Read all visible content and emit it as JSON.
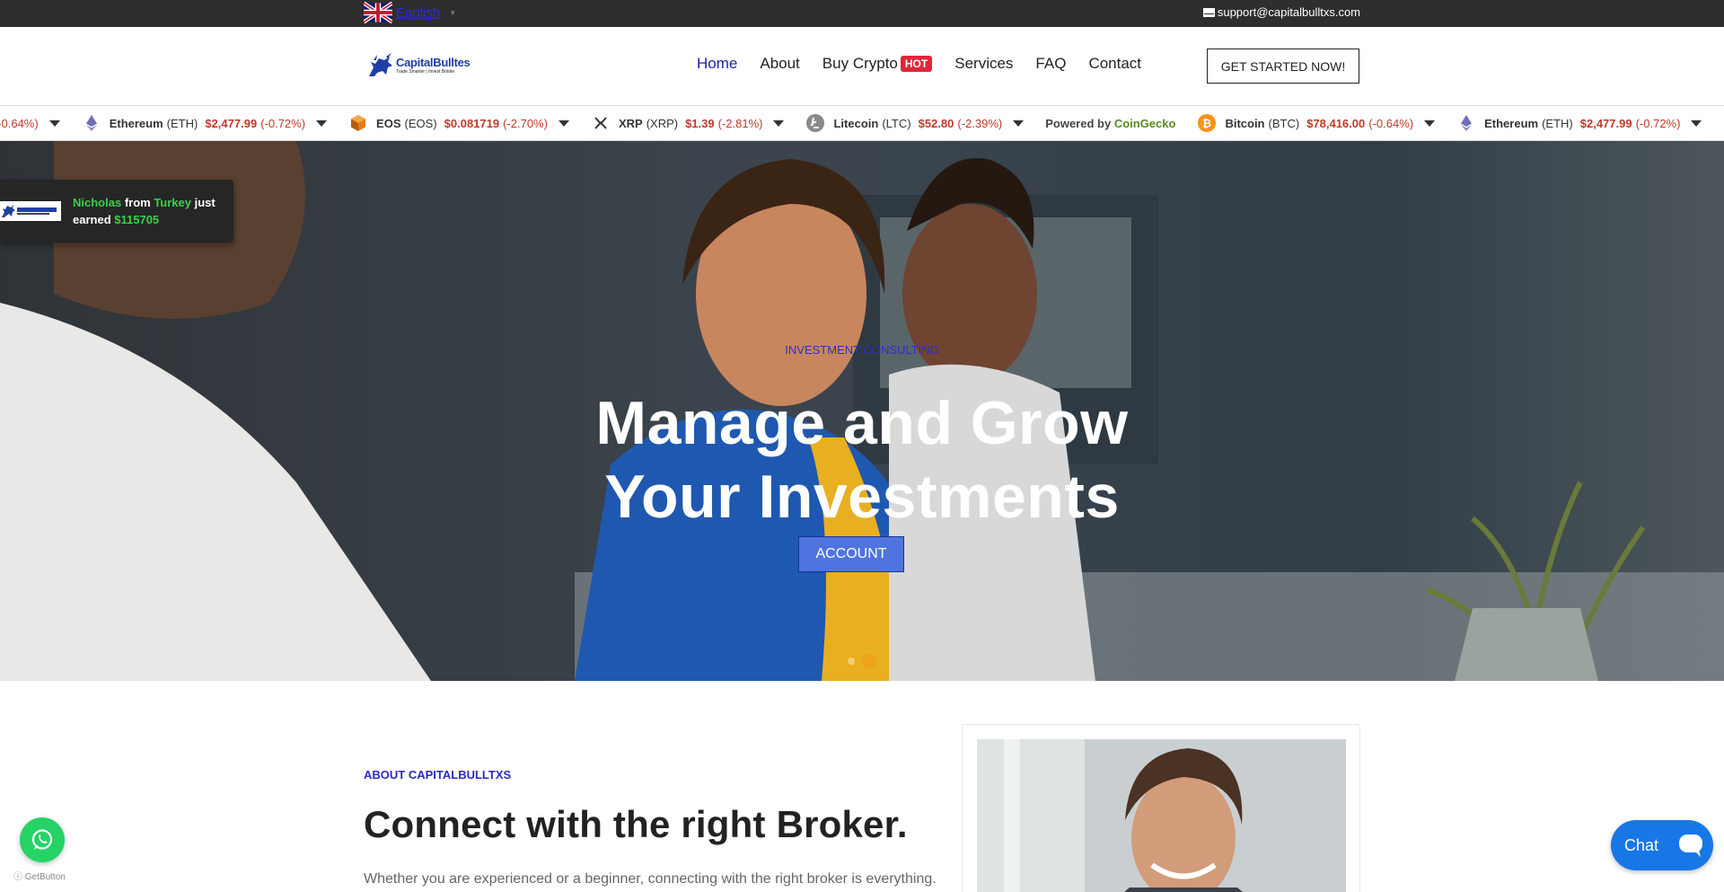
{
  "topbar": {
    "language": "English",
    "email": "support@capitalbulltxs.com"
  },
  "header": {
    "logo_name": "CapitalBulltes",
    "logo_tagline": "Trade Smarter | Invest Bolder",
    "nav": [
      {
        "label": "Home",
        "active": true
      },
      {
        "label": "About"
      },
      {
        "label": "Buy Crypto",
        "badge": "HOT"
      },
      {
        "label": "Services"
      },
      {
        "label": "FAQ"
      },
      {
        "label": "Contact"
      }
    ],
    "cta_label": "GET STARTED NOW!"
  },
  "ticker": {
    "lead_fragment": "0 (-0.64%)",
    "items": [
      {
        "name": "Ethereum",
        "symbol": "(ETH)",
        "price": "$2,477.99",
        "change": "(-0.72%)",
        "icon": "ethereum-icon"
      },
      {
        "name": "EOS",
        "symbol": "(EOS)",
        "price": "$0.081719",
        "change": "(-2.70%)",
        "icon": "eos-icon"
      },
      {
        "name": "XRP",
        "symbol": "(XRP)",
        "price": "$1.39",
        "change": "(-2.81%)",
        "icon": "xrp-icon"
      },
      {
        "name": "Litecoin",
        "symbol": "(LTC)",
        "price": "$52.80",
        "change": "(-2.39%)",
        "icon": "litecoin-icon"
      }
    ],
    "powered_by": "Powered by",
    "powered_brand": "CoinGecko",
    "items_repeat": [
      {
        "name": "Bitcoin",
        "symbol": "(BTC)",
        "price": "$78,416.00",
        "change": "(-0.64%)",
        "icon": "bitcoin-icon"
      },
      {
        "name": "Ethereum",
        "symbol": "(ETH)",
        "price": "$2,477.99",
        "change": "(-0.72%)",
        "icon": "ethereum-icon"
      }
    ],
    "tail_fragment": "E",
    "negative_color": "#c0392b"
  },
  "hero": {
    "eyebrow": "INVESTMENT CONSULTING",
    "title_line1": "Manage and Grow",
    "title_line2": "Your Investments",
    "button": "ACCOUNT",
    "slides_total": 2,
    "slide_active": 2
  },
  "notification": {
    "name": "Nicholas",
    "from": "from",
    "country": "Turkey",
    "just": "just",
    "earned": "earned",
    "amount": "$115705"
  },
  "about": {
    "eyebrow": "ABOUT CAPITALBULLTXS",
    "title": "Connect with the right Broker.",
    "body": "Whether you are experienced or a beginner, connecting with the right broker is everything."
  },
  "widgets": {
    "getbutton": "GetButton",
    "chat_label": "Chat"
  },
  "colors": {
    "brand_blue": "#1d3fa6",
    "accent_blue": "#2a2ac8",
    "hot_red": "#e0263a",
    "whatsapp_green": "#25d366",
    "chat_blue": "#1877e6",
    "earnings_green": "#3ad04a"
  }
}
